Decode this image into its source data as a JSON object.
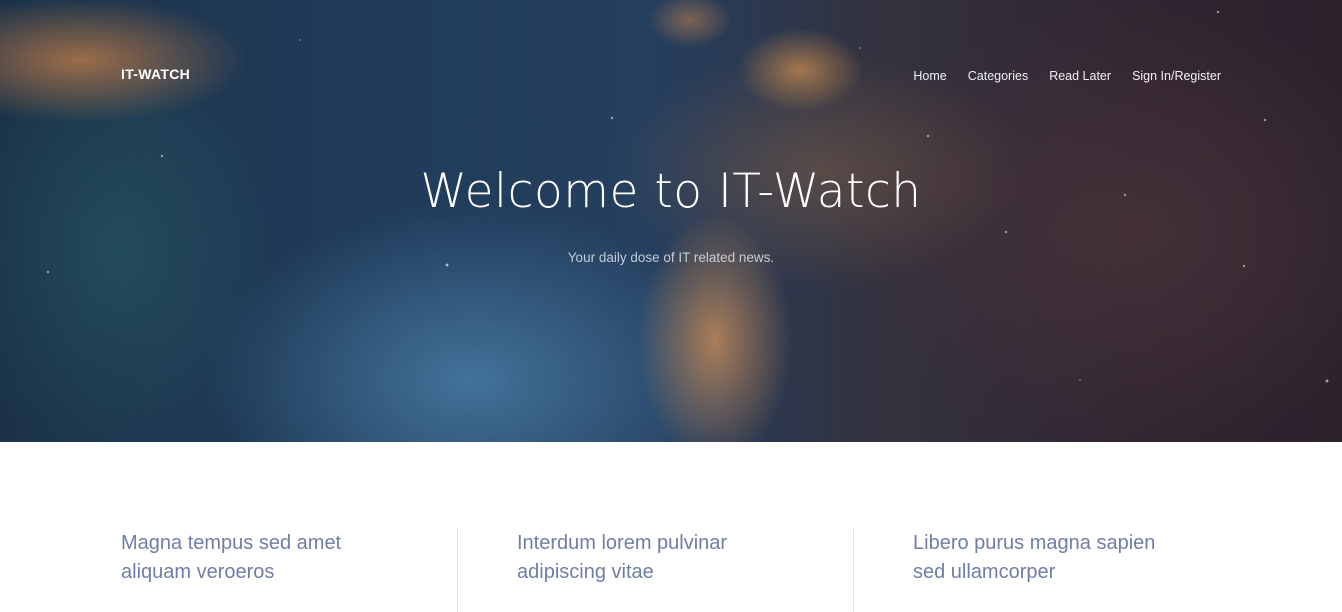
{
  "header": {
    "brand": "IT-WATCH",
    "nav": [
      {
        "label": "Home"
      },
      {
        "label": "Categories"
      },
      {
        "label": "Read Later"
      },
      {
        "label": "Sign In/Register"
      }
    ]
  },
  "hero": {
    "title": "Welcome to IT-Watch",
    "subtitle": "Your daily dose of IT related news."
  },
  "features": [
    {
      "line1": "Magna tempus sed amet",
      "line2": "aliquam veroeros"
    },
    {
      "line1": "Interdum lorem pulvinar",
      "line2": "adipiscing vitae"
    },
    {
      "line1": "Libero purus magna sapien",
      "line2": "sed ullamcorper"
    }
  ],
  "colors": {
    "feature_text": "#6e7ea6",
    "divider": "#e2e4e8",
    "hero_text": "#ffffff"
  }
}
